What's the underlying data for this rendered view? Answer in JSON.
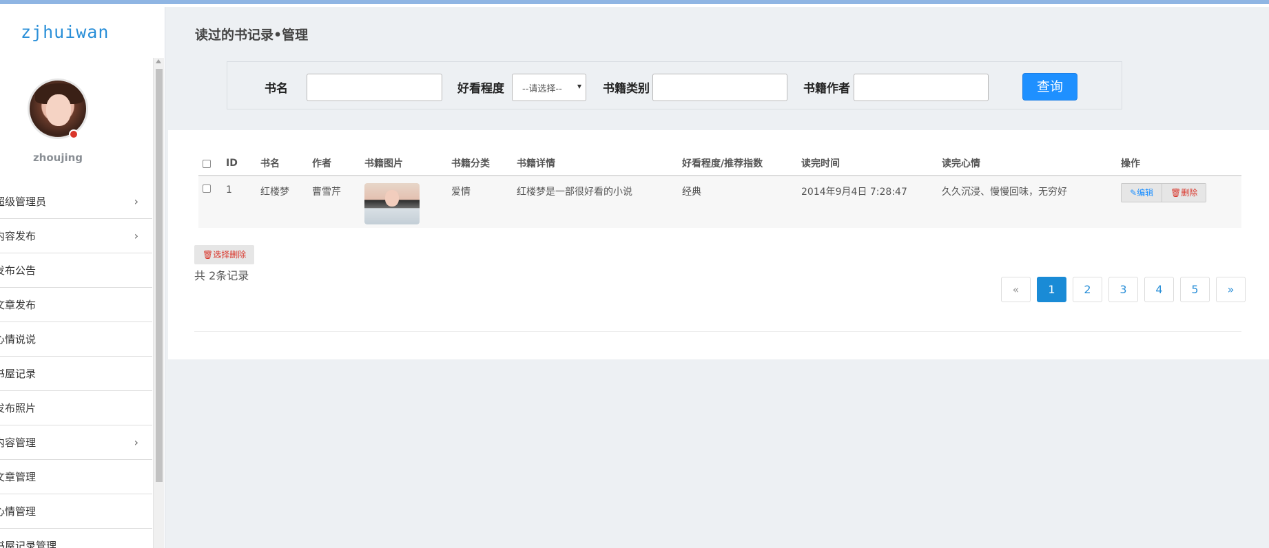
{
  "brand": "zjhuiwan",
  "user": {
    "name": "zhoujing"
  },
  "menu": [
    {
      "label": "超级管理员",
      "expandable": true
    },
    {
      "label": "内容发布",
      "expandable": true
    },
    {
      "label": "发布公告",
      "expandable": false
    },
    {
      "label": "文章发布",
      "expandable": false
    },
    {
      "label": "心情说说",
      "expandable": false
    },
    {
      "label": "书屋记录",
      "expandable": false
    },
    {
      "label": "发布照片",
      "expandable": false
    },
    {
      "label": "内容管理",
      "expandable": true
    },
    {
      "label": "文章管理",
      "expandable": false
    },
    {
      "label": "心情管理",
      "expandable": false
    },
    {
      "label": "书屋记录管理",
      "expandable": false
    }
  ],
  "page": {
    "title": "读过的书记录•管理"
  },
  "search": {
    "book_name_label": "书名",
    "rating_label": "好看程度",
    "rating_selected": "--请选择--",
    "category_label": "书籍类别",
    "author_label": "书籍作者",
    "query_button": "查询"
  },
  "table": {
    "headers": [
      "ID",
      "书名",
      "作者",
      "书籍图片",
      "书籍分类",
      "书籍详情",
      "好看程度/推荐指数",
      "读完时间",
      "读完心情",
      "操作"
    ],
    "rows": [
      {
        "id": "1",
        "name": "红楼梦",
        "author": "曹雪芹",
        "category": "爱情",
        "detail": "红楼梦是一部很好看的小说",
        "rating": "经典",
        "finished_at": "2014年9月4日 7:28:47",
        "mood": "久久沉浸、慢慢回味，无穷好",
        "edit_label": "编辑",
        "delete_label": "删除"
      }
    ]
  },
  "bulk_delete_label": "选择删除",
  "total_text": "共 2条记录",
  "pagination": {
    "prev": "«",
    "pages": [
      "1",
      "2",
      "3",
      "4",
      "5"
    ],
    "active": "1",
    "next": "»"
  },
  "colors": {
    "accent": "#1e90ff",
    "danger": "#d9362b",
    "brand": "#2a8fd8"
  }
}
